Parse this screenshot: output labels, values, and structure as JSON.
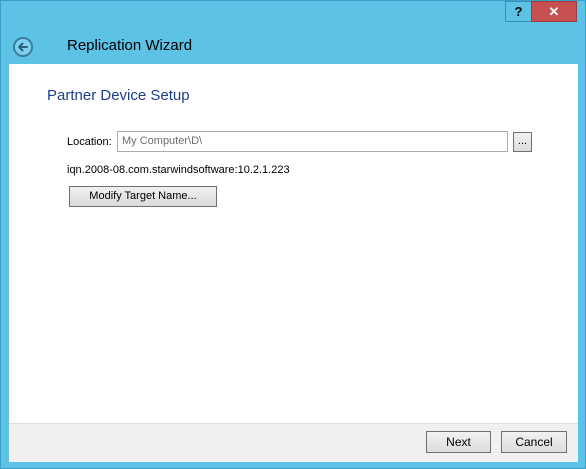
{
  "titlebar": {
    "help_label": "?",
    "close_label": "✕"
  },
  "header": {
    "title": "Replication Wizard"
  },
  "main": {
    "section_title": "Partner Device Setup",
    "location_label": "Location:",
    "location_value": "My Computer\\D\\",
    "browse_label": "...",
    "iqn": "iqn.2008-08.com.starwindsoftware:10.2.1.223",
    "modify_label": "Modify Target Name..."
  },
  "footer": {
    "next_label": "Next",
    "cancel_label": "Cancel"
  },
  "icons": {
    "back": "back-arrow-icon"
  }
}
